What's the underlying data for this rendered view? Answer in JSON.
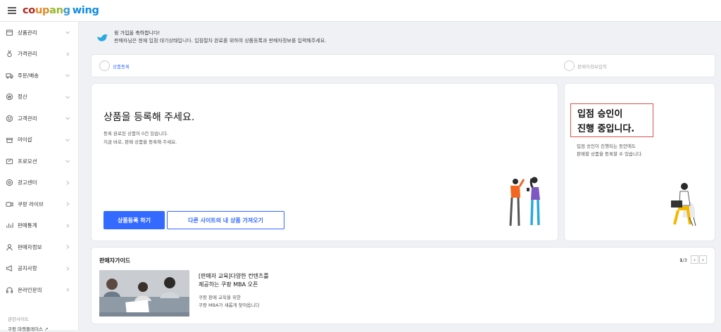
{
  "header": {
    "logo": {
      "c1": "co",
      "c2": "up",
      "c3": "an",
      "c4": "g",
      "wing": "wing"
    }
  },
  "sidebar": {
    "items": [
      {
        "label": "상품관리",
        "icon": "box-icon"
      },
      {
        "label": "가격관리",
        "icon": "medal-icon"
      },
      {
        "label": "주문/배송",
        "icon": "truck-icon"
      },
      {
        "label": "정산",
        "icon": "won-coin-icon"
      },
      {
        "label": "고객관리",
        "icon": "smile-icon"
      },
      {
        "label": "마이샵",
        "icon": "shop-icon"
      },
      {
        "label": "프로모션",
        "icon": "coupon-icon"
      },
      {
        "label": "광고센터",
        "icon": "ad-target-icon"
      },
      {
        "label": "쿠팡 라이브",
        "icon": "live-video-icon"
      },
      {
        "label": "판매통계",
        "icon": "bar-chart-icon"
      },
      {
        "label": "판매자정보",
        "icon": "person-icon"
      },
      {
        "label": "공지사항",
        "icon": "megaphone-icon"
      },
      {
        "label": "온라인문의",
        "icon": "headset-icon"
      }
    ],
    "related_title": "관련사이트",
    "related_link": "쿠팡 마켓플레이스 ↗"
  },
  "welcome": {
    "line1": "윙 가입을 축하합니다!",
    "line2": "판매자님은 현재 입점 대기상태입니다. 입점절차 완료를 위하여 상품등록과 판매자정보를 입력해주세요."
  },
  "steps": [
    {
      "label": "상품등록"
    },
    {
      "label": "판매자정보입력"
    }
  ],
  "main_card": {
    "title": "상품을 등록해 주세요.",
    "desc1": "등록 완료된 상품이 0건 있습니다.",
    "desc2": "지금 바로, 판매 상품을 등록해 주세요.",
    "primary_button": "상품등록 하기",
    "secondary_button": "다른 사이트의 내 상품 가져오기"
  },
  "side_card": {
    "title1": "입점 승인이",
    "title2": "진행 중입니다.",
    "desc1": "입점 승인이 진행되는 동안에도",
    "desc2": "판매할 상품을 등록할 수 있습니다."
  },
  "guide": {
    "title": "판매자가이드",
    "pager_current": "1",
    "pager_total": "/3",
    "article_title1": "[판매자 교육]다양한 컨텐츠를",
    "article_title2": "제공하는 쿠팡 MBA 오픈",
    "article_desc1": "쿠팡 판매 교육을 위한",
    "article_desc2": "쿠팡 MBA가 새롭게 찾아옵니다"
  },
  "colors": {
    "primary": "#346aff",
    "highlight_box": "#d9534f",
    "bird": "#2aa9e0"
  }
}
